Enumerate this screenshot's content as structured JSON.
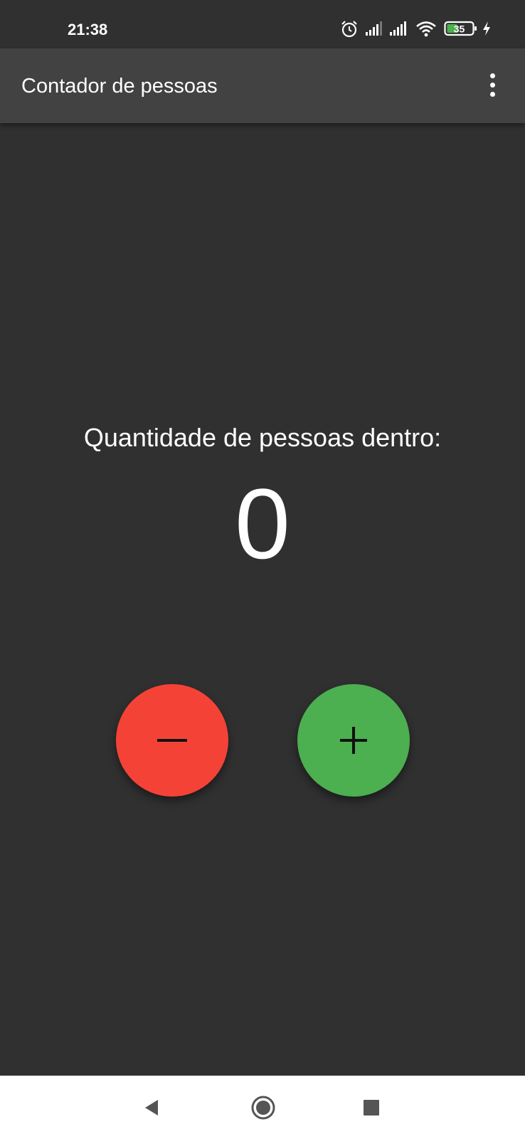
{
  "status_bar": {
    "time": "21:38",
    "battery_level": "35",
    "icons": [
      "alarm-icon",
      "signal-icon",
      "signal-icon",
      "wifi-icon",
      "battery-icon",
      "charging-icon"
    ]
  },
  "app_bar": {
    "title": "Contador de pessoas",
    "menu_icon": "more-vert-icon"
  },
  "main": {
    "label": "Quantidade de pessoas dentro:",
    "count": "0",
    "decrement_button": {
      "icon": "minus-icon",
      "color": "#f44336"
    },
    "increment_button": {
      "icon": "plus-icon",
      "color": "#4caf50"
    }
  },
  "nav_bar": {
    "items": [
      "back-icon",
      "home-icon",
      "recents-icon"
    ]
  },
  "colors": {
    "background": "#303030",
    "app_bar": "#424242",
    "text": "#ffffff"
  }
}
